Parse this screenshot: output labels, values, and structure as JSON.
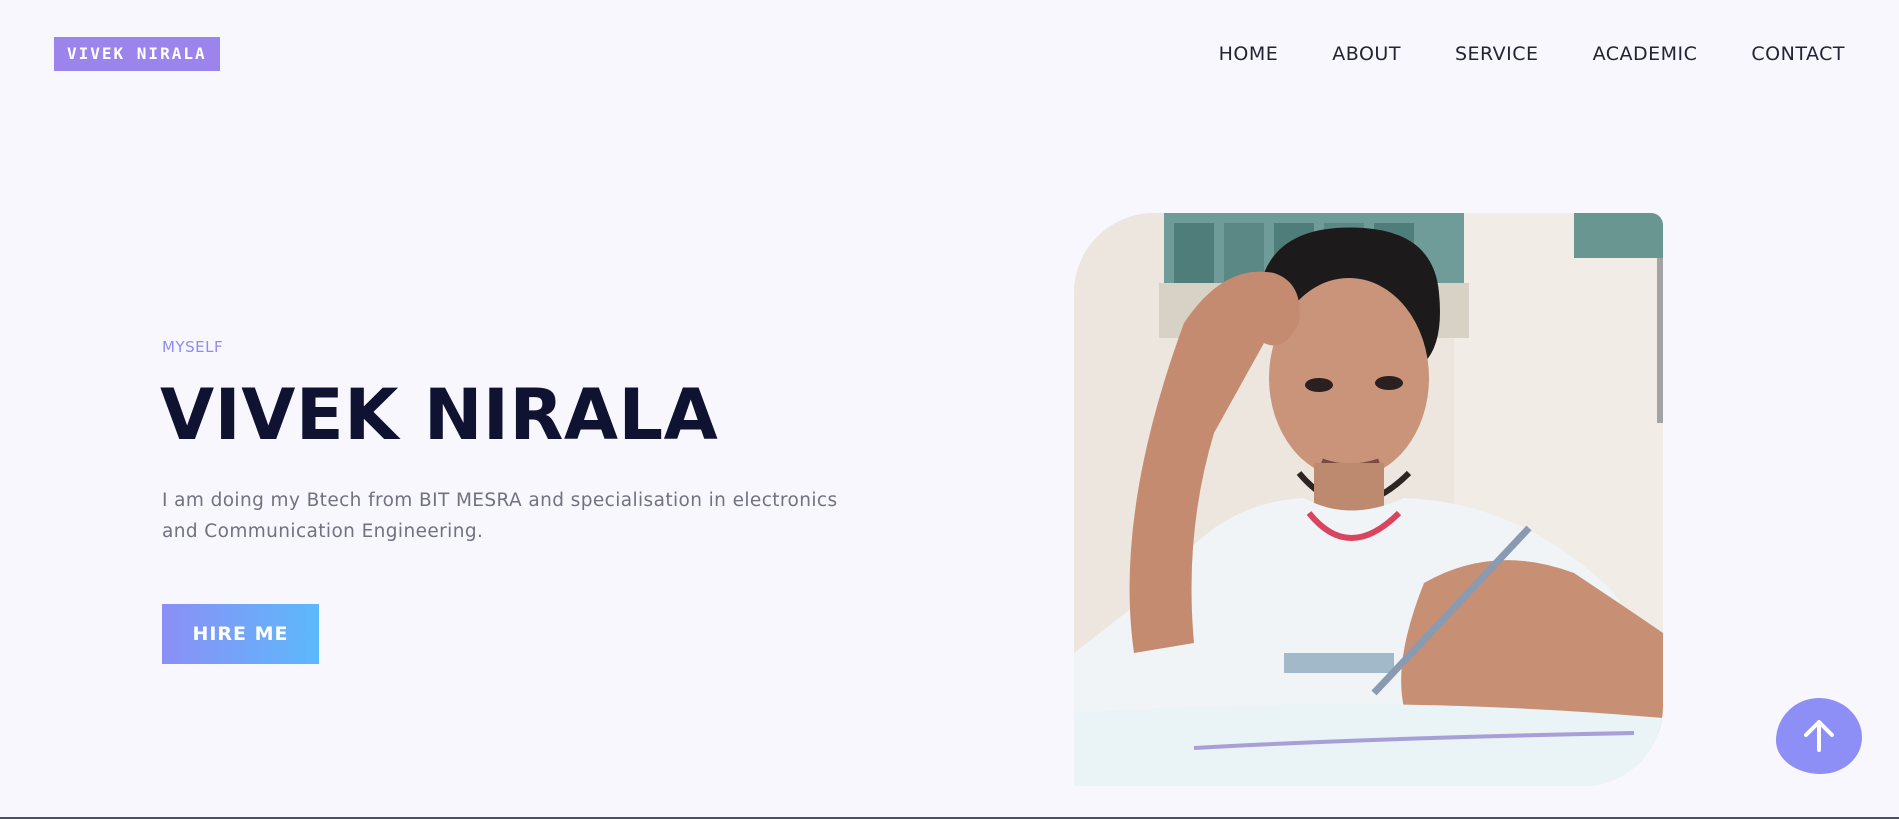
{
  "header": {
    "logo": "VIVEK NIRALA",
    "nav": [
      {
        "label": "HOME"
      },
      {
        "label": "ABOUT"
      },
      {
        "label": "SERVICE"
      },
      {
        "label": "ACADEMIC"
      },
      {
        "label": "CONTACT"
      }
    ]
  },
  "hero": {
    "eyebrow": "MYSELF",
    "title": "VIVEK NIRALA",
    "description": "I am doing my Btech from BIT MESRA and specialisation in electronics and Communication Engineering.",
    "cta_label": "HIRE ME",
    "photo_icon": "profile-photo"
  },
  "scroll_top": {
    "icon": "arrow-up-icon"
  },
  "colors": {
    "accent": "#9b85ec",
    "button_gradient_start": "#8b8ff6",
    "button_gradient_end": "#5cb9fb",
    "eyebrow": "#8f8bf2",
    "title": "#0f1230",
    "background": "#f8f7fe"
  }
}
